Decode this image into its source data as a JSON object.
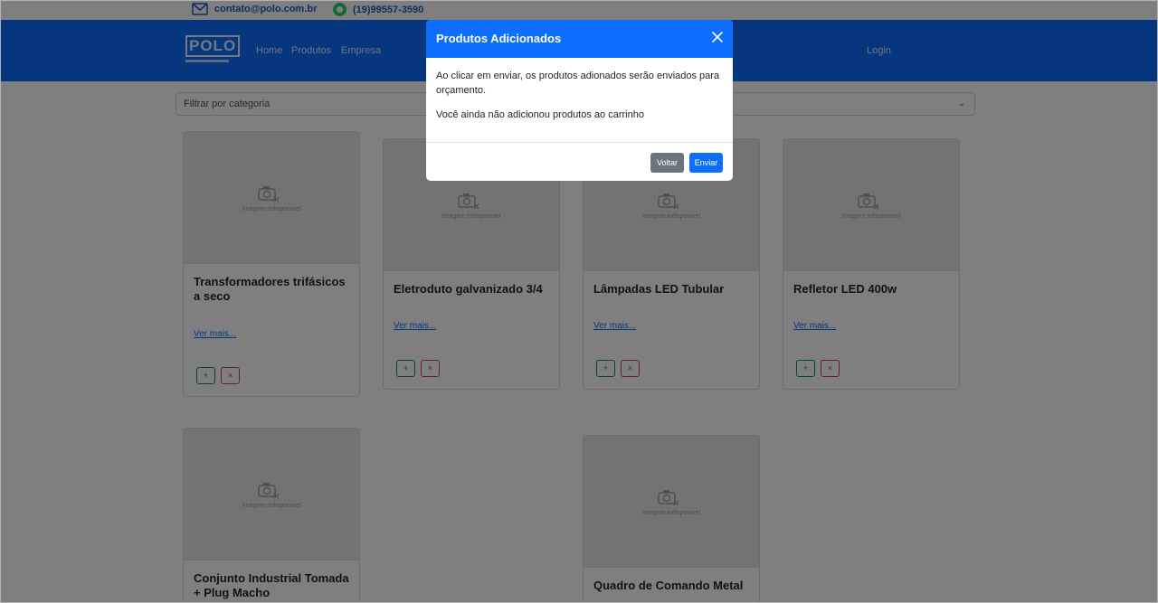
{
  "contact": {
    "email": "contato@polo.com.br",
    "phone": "(19)99557-3590"
  },
  "navbar": {
    "logo_text": "POLO",
    "links": [
      "Home",
      "Produtos",
      "Empresa"
    ],
    "login": "Login"
  },
  "filter": {
    "selected": "Filtrar por categoria"
  },
  "products": [
    {
      "title_line1": "Transformadores trifásicos",
      "title_line2": "a seco",
      "more": "Ver mais...",
      "image_text": "Imagem indisponível"
    },
    {
      "title_line1": "Eletroduto galvanizado 3/4",
      "title_line2": "",
      "more": "Ver mais...",
      "image_text": "Imagem indisponível"
    },
    {
      "title_line1": "Lâmpadas LED Tubular",
      "title_line2": "",
      "more": "Ver mais...",
      "image_text": "Imagem indisponível"
    },
    {
      "title_line1": "Refletor LED 400w",
      "title_line2": "",
      "more": "Ver mais...",
      "image_text": "Imagem indisponível"
    },
    {
      "title_line1": "Conjunto Industrial Tomada",
      "title_line2": "+ Plug Macho",
      "more": "",
      "image_text": "Imagem indisponível"
    },
    {
      "title_line1": "Quadro de Comando Metal",
      "title_line2": "",
      "more": "",
      "image_text": "Imagem indisponível"
    }
  ],
  "card_buttons": {
    "add": "+",
    "remove": "×"
  },
  "modal": {
    "title": "Produtos Adicionados",
    "body_line1": "Ao clicar em enviar, os produtos adionados serão enviados para orçamento.",
    "body_line2": "Você ainda não adicionou produtos ao carrinho",
    "back_label": "Voltar",
    "send_label": "Enviar"
  },
  "colors": {
    "primary": "#0d6efd",
    "secondary": "#6c757d",
    "success": "#198754",
    "danger": "#dc3545"
  }
}
